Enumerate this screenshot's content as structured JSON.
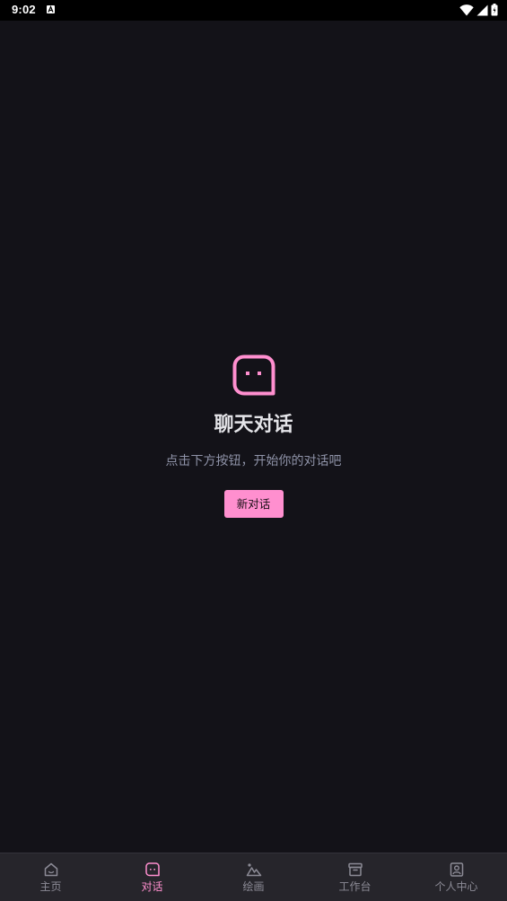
{
  "status_bar": {
    "time": "9:02"
  },
  "empty_state": {
    "icon": "chat-bubble-icon",
    "title": "聊天对话",
    "subtitle": "点击下方按钮，开始你的对话吧",
    "button_label": "新对话"
  },
  "bottom_nav": {
    "items": [
      {
        "label": "主页",
        "icon": "home-icon",
        "active": false
      },
      {
        "label": "对话",
        "icon": "chat-icon",
        "active": true
      },
      {
        "label": "绘画",
        "icon": "paint-icon",
        "active": false
      },
      {
        "label": "工作台",
        "icon": "workbench-icon",
        "active": false
      },
      {
        "label": "个人中心",
        "icon": "profile-icon",
        "active": false
      }
    ]
  },
  "colors": {
    "background": "#131218",
    "accent": "#ff8fcf",
    "nav_background": "#26252b",
    "nav_inactive": "#8c8b96",
    "title": "#e4e4e8",
    "subtitle": "#8f93a8"
  }
}
